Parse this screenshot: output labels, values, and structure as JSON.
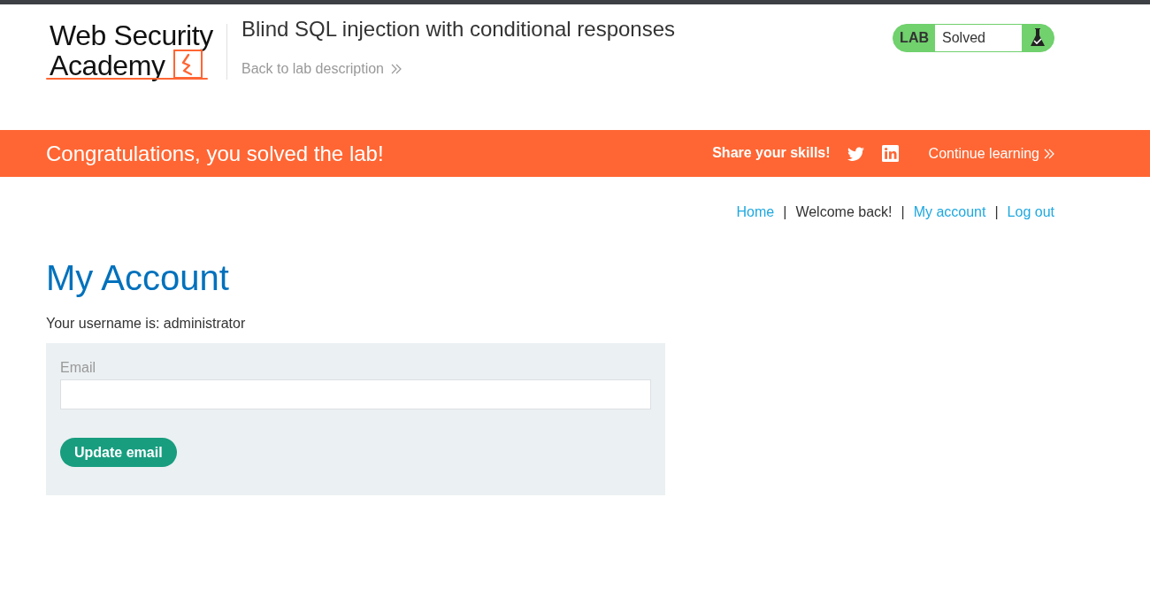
{
  "header": {
    "logo": {
      "line_1": "Web Security",
      "line_2": "Academy"
    },
    "lab_title": "Blind SQL injection with conditional responses",
    "back_link": "Back to lab description",
    "lab_status": {
      "label": "LAB",
      "status": "Solved",
      "solved": true
    }
  },
  "banner": {
    "message": "Congratulations, you solved the lab!",
    "share_label": "Share your skills!",
    "continue_link": "Continue learning"
  },
  "nav": {
    "items": [
      {
        "kind": "link",
        "label": "Home"
      },
      {
        "kind": "separator",
        "label": "|"
      },
      {
        "kind": "text",
        "label": "Welcome back!"
      },
      {
        "kind": "separator",
        "label": "|"
      },
      {
        "kind": "link",
        "label": "My account"
      },
      {
        "kind": "separator",
        "label": "|"
      },
      {
        "kind": "link",
        "label": "Log out"
      }
    ]
  },
  "account": {
    "heading": "My Account",
    "username_line": "Your username is: administrator",
    "form": {
      "email_label": "Email",
      "button": "Update email"
    }
  }
}
